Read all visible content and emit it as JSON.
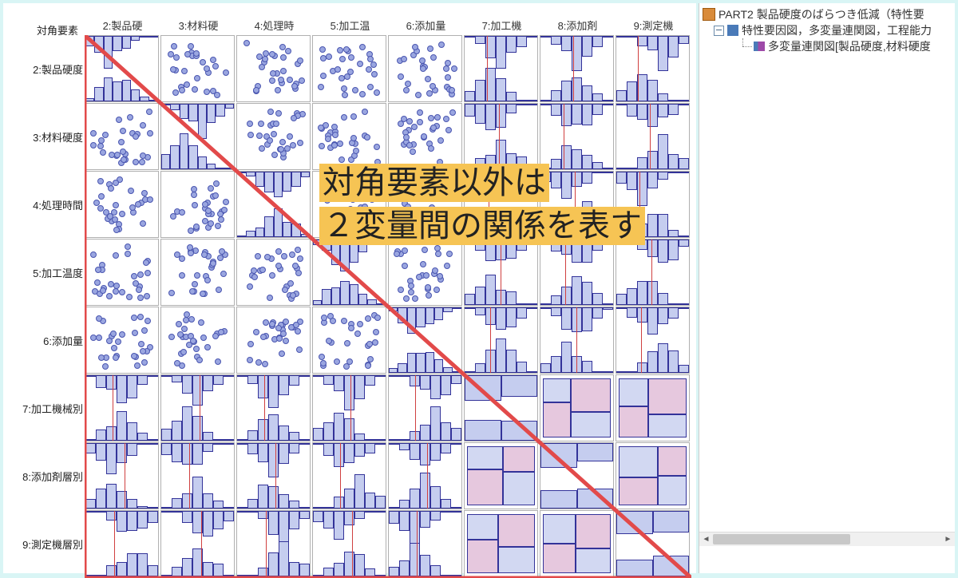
{
  "corner_label": "対角要素",
  "col_headers": [
    "2:製品硬",
    "3:材料硬",
    "4:処理時",
    "5:加工温",
    "6:添加量",
    "7:加工機",
    "8:添加剤",
    "9:測定機"
  ],
  "row_labels": [
    "2:製品硬度",
    "3:材料硬度",
    "4:処理時間",
    "5:加工温度",
    "6:添加量",
    "7:加工機械別",
    "8:添加剤層別",
    "9:測定機層別"
  ],
  "annotation_line1": "対角要素以外は",
  "annotation_line2": "２変量間の関係を表す",
  "tree": {
    "root": "PART2 製品硬度のばらつき低減（特性要",
    "node1": "特性要因図，多変量連関図，工程能力",
    "node2": "多変量連関図[製品硬度,材料硬度"
  },
  "chart_data": {
    "type": "scatterplot-matrix",
    "note": "8×8 multivariate correlation matrix. Diagonal cells show histograms; off-diagonal lower-left cells show scatterplots between continuous variables, side-by-side histograms for continuous×categorical, and mosaic plots for categorical×categorical.",
    "variables": [
      {
        "index": 2,
        "name": "製品硬度",
        "type": "continuous"
      },
      {
        "index": 3,
        "name": "材料硬度",
        "type": "continuous"
      },
      {
        "index": 4,
        "name": "処理時間",
        "type": "continuous"
      },
      {
        "index": 5,
        "name": "加工温度",
        "type": "continuous"
      },
      {
        "index": 6,
        "name": "添加量",
        "type": "continuous"
      },
      {
        "index": 7,
        "name": "加工機械別",
        "type": "categorical",
        "levels": 2
      },
      {
        "index": 8,
        "name": "添加剤層別",
        "type": "categorical",
        "levels": 2
      },
      {
        "index": 9,
        "name": "測定機層別",
        "type": "categorical",
        "levels": 2
      }
    ]
  }
}
